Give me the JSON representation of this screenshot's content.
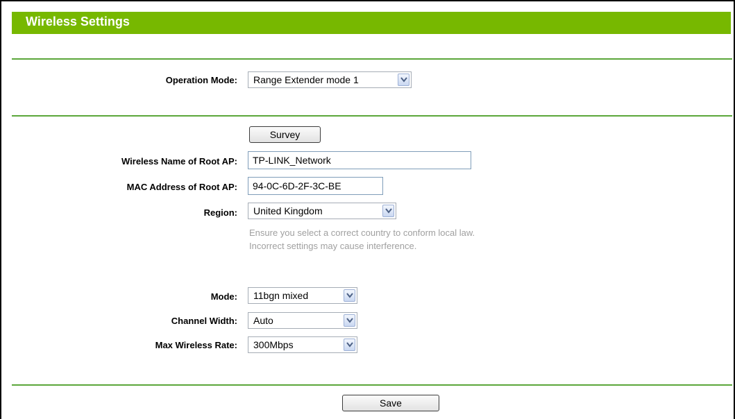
{
  "header": {
    "title": "Wireless Settings"
  },
  "operation_mode": {
    "label": "Operation Mode:",
    "value": "Range Extender mode 1"
  },
  "survey_button": "Survey",
  "root_ap_name": {
    "label": "Wireless Name of Root AP:",
    "value": "TP-LINK_Network"
  },
  "root_ap_mac": {
    "label": "MAC Address of Root AP:",
    "value": "94-0C-6D-2F-3C-BE"
  },
  "region": {
    "label": "Region:",
    "value": "United Kingdom",
    "hint_line1": "Ensure you select a correct country to conform local law.",
    "hint_line2": "Incorrect settings may cause interference."
  },
  "mode": {
    "label": "Mode:",
    "value": "11bgn mixed"
  },
  "channel_width": {
    "label": "Channel Width:",
    "value": "Auto"
  },
  "max_rate": {
    "label": "Max Wireless Rate:",
    "value": "300Mbps"
  },
  "save_button": "Save",
  "colors": {
    "header_green": "#77b800",
    "rule_green": "#5aa63a",
    "hint_gray": "#a0a0a0"
  }
}
